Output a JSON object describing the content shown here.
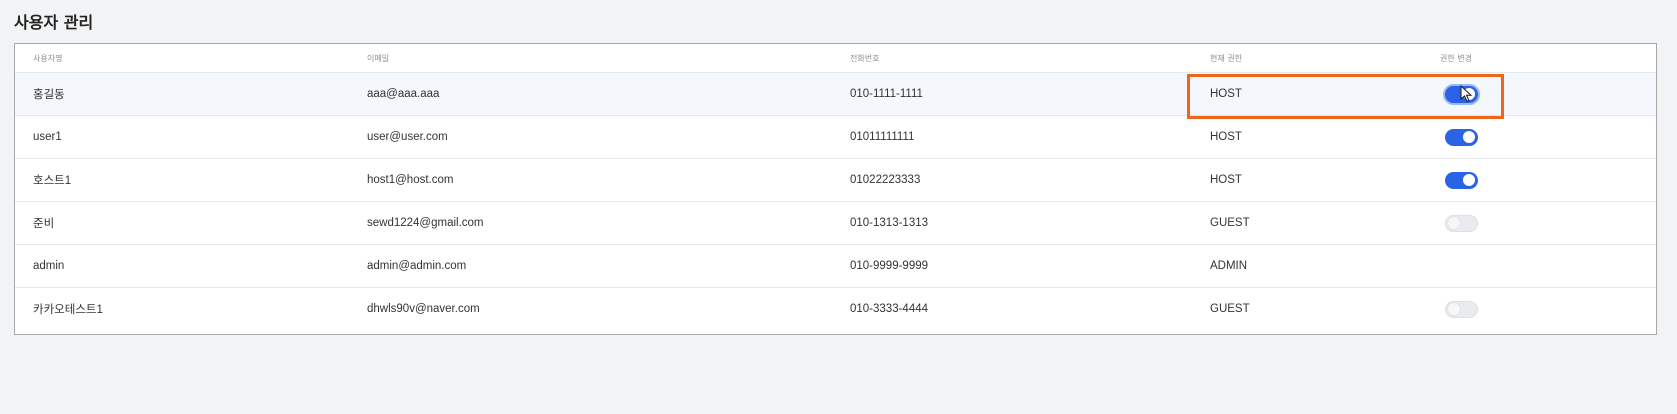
{
  "page": {
    "title": "사용자 관리"
  },
  "table": {
    "columns": [
      "사용자명",
      "이메일",
      "전화번호",
      "현재 권한",
      "권한 변경"
    ],
    "rows": [
      {
        "name": "홍길동",
        "email": "aaa@aaa.aaa",
        "phone": "010-1111-1111",
        "role": "HOST",
        "toggle": "on"
      },
      {
        "name": "user1",
        "email": "user@user.com",
        "phone": "01011111111",
        "role": "HOST",
        "toggle": "on"
      },
      {
        "name": "호스트1",
        "email": "host1@host.com",
        "phone": "01022223333",
        "role": "HOST",
        "toggle": "on"
      },
      {
        "name": "준비",
        "email": "sewd1224@gmail.com",
        "phone": "010-1313-1313",
        "role": "GUEST",
        "toggle": "off"
      },
      {
        "name": "admin",
        "email": "admin@admin.com",
        "phone": "010-9999-9999",
        "role": "ADMIN",
        "toggle": "none"
      },
      {
        "name": "카카오테스트1",
        "email": "dhwls90v@naver.com",
        "phone": "010-3333-4444",
        "role": "GUEST",
        "toggle": "off"
      }
    ]
  },
  "colors": {
    "toggle_on": "#2b63e6",
    "toggle_off": "#e9ebee",
    "highlight": "#f0651c",
    "background": "#f1f3f5"
  },
  "icons": {
    "cursor": "mouse-pointer-icon"
  }
}
